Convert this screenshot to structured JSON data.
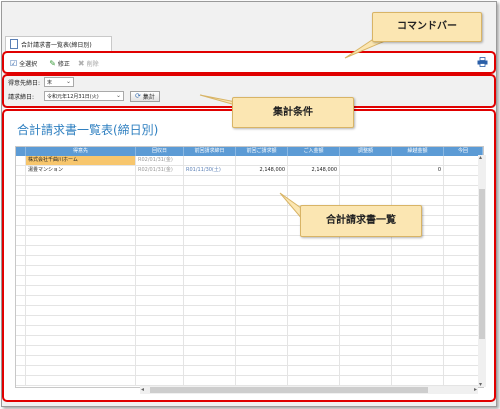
{
  "window": {
    "tab_title": "合計請求書一覧表(締日別)"
  },
  "command_bar": {
    "select_all": "全選択",
    "edit": "修正",
    "delete": "削除"
  },
  "conditions": {
    "closing_day_label": "得意先締日:",
    "closing_day_value": "末",
    "billing_date_label": "請求締日:",
    "billing_date_value": "令和元年12月31日(火)",
    "aggregate_button": "集計"
  },
  "list": {
    "title": "合計請求書一覧表(締日別)",
    "columns": [
      "",
      "得意先",
      "回収日",
      "前回請求締日",
      "前回ご請求額",
      "ご入金額",
      "調整額",
      "繰越金額",
      "今回"
    ],
    "rows": [
      {
        "customer": "株式会社千曲川ホーム",
        "collect_date": "R02/01/31(金)",
        "prev_close": "",
        "prev_amount": "",
        "paid": "",
        "adjust": "",
        "carry": ""
      },
      {
        "customer": "湯畳マンション",
        "collect_date": "R02/01/31(金)",
        "prev_close": "R01/11/30(土)",
        "prev_amount": "2,148,000",
        "paid": "2,148,000",
        "adjust": "",
        "carry": "0"
      }
    ]
  },
  "callouts": {
    "command_bar": "コマンドバー",
    "conditions": "集計条件",
    "list": "合計請求書一覧"
  },
  "colors": {
    "accent": "#2e7fc0",
    "header": "#5c9bd5",
    "highlight_red": "#e00000",
    "callout_bg": "#fbe6b2"
  }
}
